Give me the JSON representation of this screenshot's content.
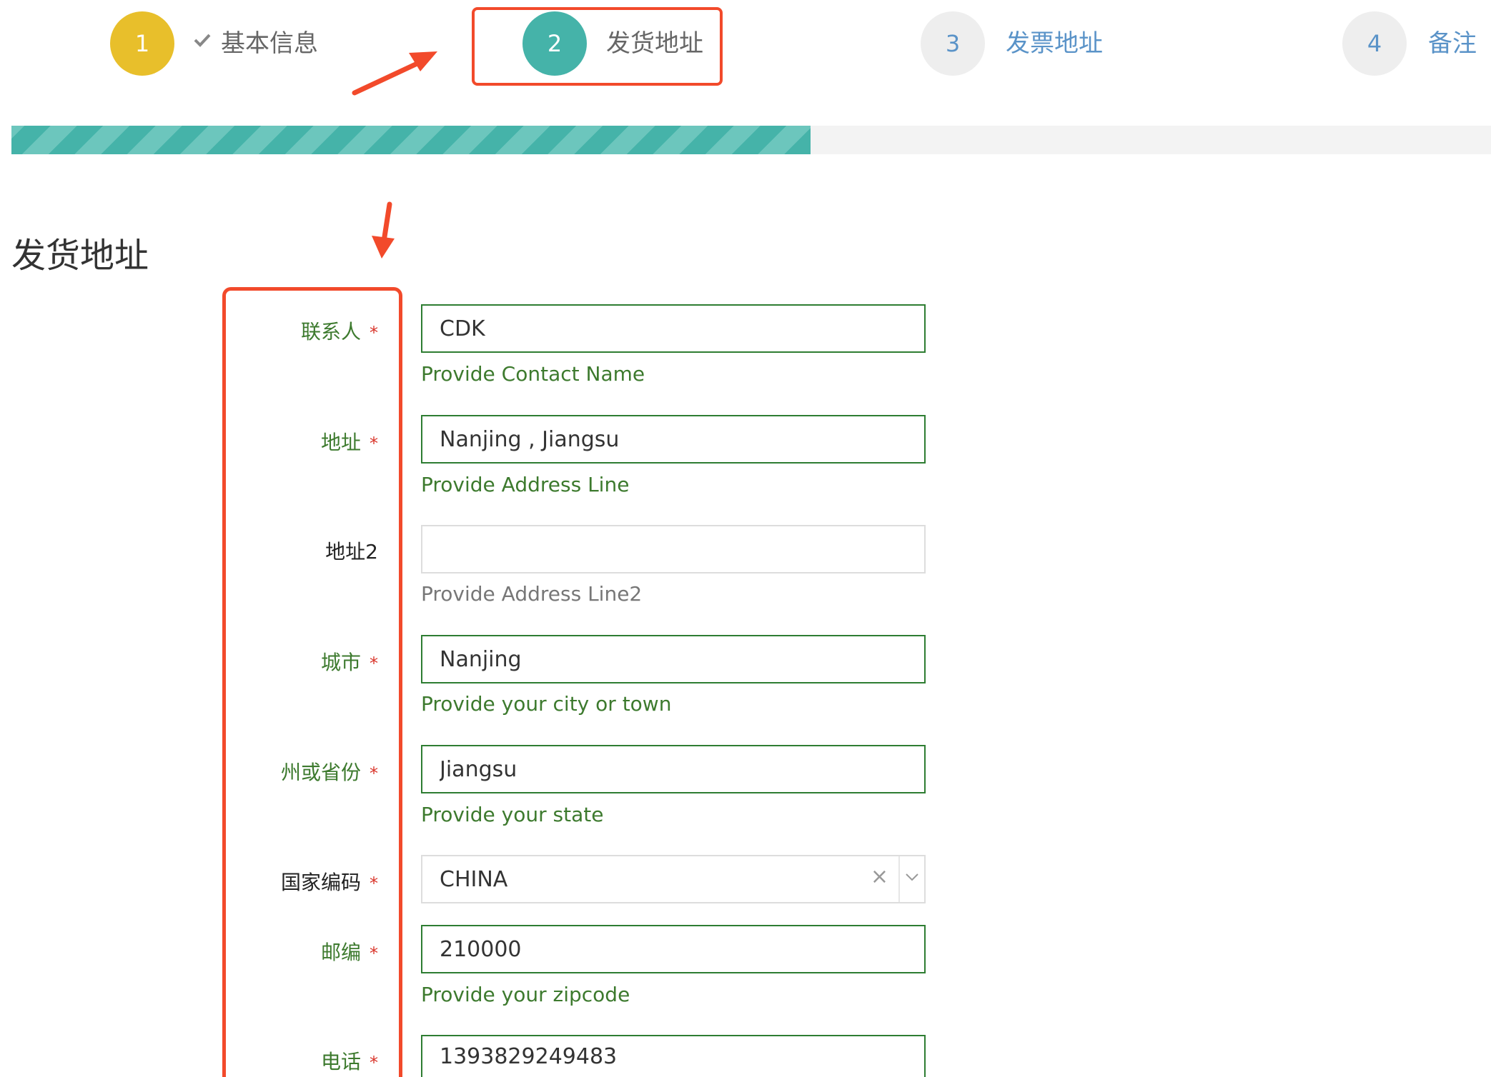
{
  "stepper": {
    "steps": [
      {
        "number": "1",
        "label": "基本信息",
        "state": "completed",
        "icon": "check-icon"
      },
      {
        "number": "2",
        "label": "发货地址",
        "state": "active"
      },
      {
        "number": "3",
        "label": "发票地址",
        "state": "upcoming"
      },
      {
        "number": "4",
        "label": "备注",
        "state": "upcoming"
      }
    ],
    "progress_fraction": 0.54
  },
  "section": {
    "title": "发货地址"
  },
  "form": {
    "fields": [
      {
        "label": "联系人",
        "required_mark": "*",
        "value": "CDK",
        "help": "Provide Contact Name"
      },
      {
        "label": "地址",
        "required_mark": "*",
        "value": "Nanjing , Jiangsu",
        "help": "Provide Address Line"
      },
      {
        "label": "地址2",
        "value": "",
        "help": "Provide Address Line2"
      },
      {
        "label": "城市",
        "required_mark": "*",
        "value": "Nanjing",
        "help": "Provide your city or town"
      },
      {
        "label": "州或省份",
        "required_mark": "*",
        "value": "Jiangsu",
        "help": "Provide your state"
      },
      {
        "label": "国家编码",
        "required_mark": "*",
        "value": "CHINA",
        "clear": "×",
        "type": "select"
      },
      {
        "label": "邮编",
        "required_mark": "*",
        "value": "210000",
        "help": "Provide your zipcode"
      },
      {
        "label": "电话",
        "required_mark": "*",
        "value": "1393829249483"
      }
    ]
  },
  "colors": {
    "step1": "#e8bf2b",
    "active_step": "#45b3a9",
    "upcoming_text": "#5a93c8",
    "valid": "#3d7a2e",
    "annotation_red": "#f24a2b"
  }
}
